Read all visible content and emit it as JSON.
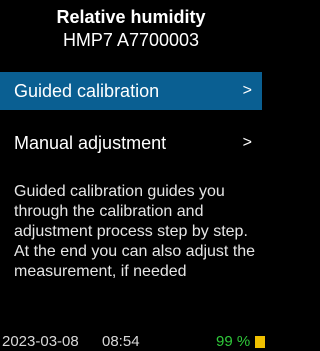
{
  "header": {
    "title": "Relative humidity",
    "subtitle": "HMP7 A7700003"
  },
  "menu": {
    "items": [
      {
        "label": "Guided calibration",
        "chevron": ">",
        "selected": true
      },
      {
        "label": "Manual adjustment",
        "chevron": ">",
        "selected": false
      }
    ]
  },
  "description": "Guided calibration guides you through the calibration and adjustment process step by step. At the end you can also adjust the measurement, if needed",
  "status": {
    "date": "2023-03-08",
    "time": "08:54",
    "battery": "99 %",
    "battery_icon": "battery-icon"
  },
  "colors": {
    "background": "#000000",
    "selected": "#0a5f92",
    "battery_text": "#2fc93a",
    "battery_icon": "#f0c000"
  }
}
